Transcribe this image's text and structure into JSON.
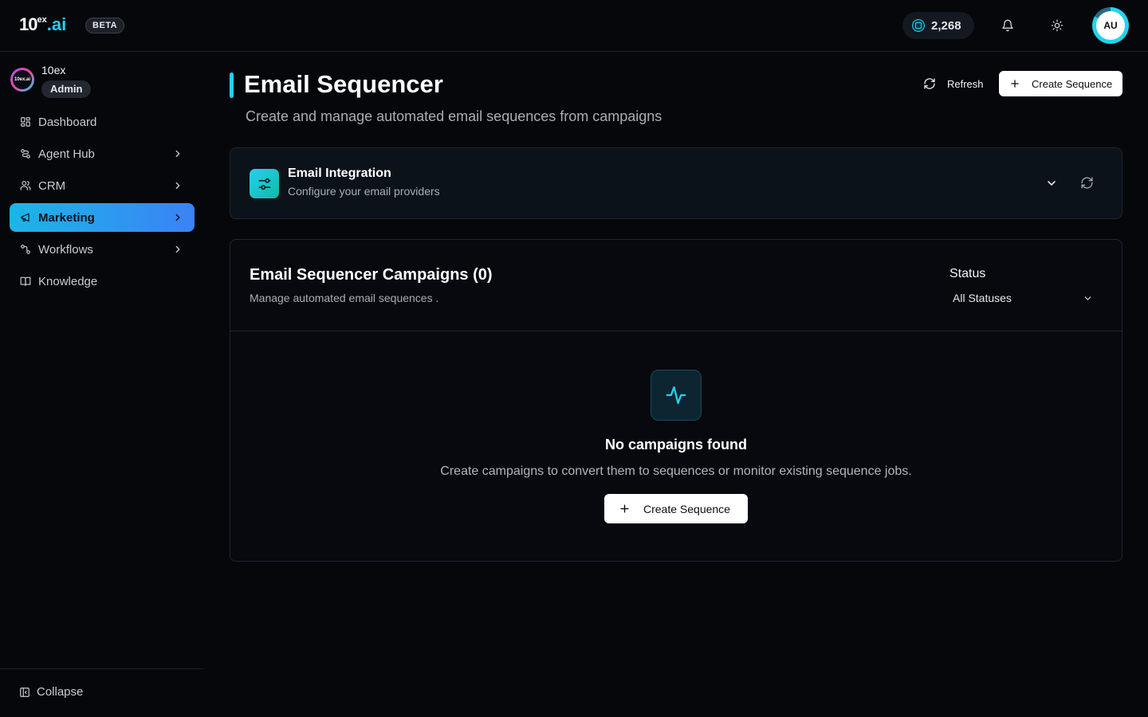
{
  "header": {
    "logo_main": "10",
    "logo_sup": "ex",
    "logo_ai": ".ai",
    "beta": "BETA",
    "credits": "2,268",
    "avatar_initials": "AU"
  },
  "sidebar": {
    "org_name": "10ex",
    "org_logo_text": "10ex.ai",
    "org_role": "Admin",
    "items": [
      {
        "label": "Dashboard",
        "icon": "grid-icon",
        "has_chevron": false,
        "active": false
      },
      {
        "label": "Agent Hub",
        "icon": "route-icon",
        "has_chevron": true,
        "active": false
      },
      {
        "label": "CRM",
        "icon": "users-icon",
        "has_chevron": true,
        "active": false
      },
      {
        "label": "Marketing",
        "icon": "megaphone-icon",
        "has_chevron": true,
        "active": true
      },
      {
        "label": "Workflows",
        "icon": "workflow-icon",
        "has_chevron": true,
        "active": false
      },
      {
        "label": "Knowledge",
        "icon": "book-icon",
        "has_chevron": false,
        "active": false
      }
    ],
    "collapse_label": "Collapse"
  },
  "page": {
    "title": "Email Sequencer",
    "subtitle": "Create and manage automated email sequences from campaigns",
    "refresh_label": "Refresh",
    "create_label": "Create Sequence"
  },
  "integration": {
    "title": "Email Integration",
    "subtitle": "Configure your email providers"
  },
  "campaigns": {
    "title": "Email Sequencer Campaigns (0)",
    "subtitle": "Manage automated email sequences .",
    "status_label": "Status",
    "status_value": "All Statuses",
    "empty_title": "No campaigns found",
    "empty_subtitle": "Create campaigns to convert them to sequences or monitor existing sequence jobs.",
    "empty_button": "Create Sequence"
  },
  "colors": {
    "accent": "#22d3ee",
    "active_nav_start": "#1bb6e6",
    "active_nav_end": "#3b82f6",
    "background": "#05070b"
  }
}
